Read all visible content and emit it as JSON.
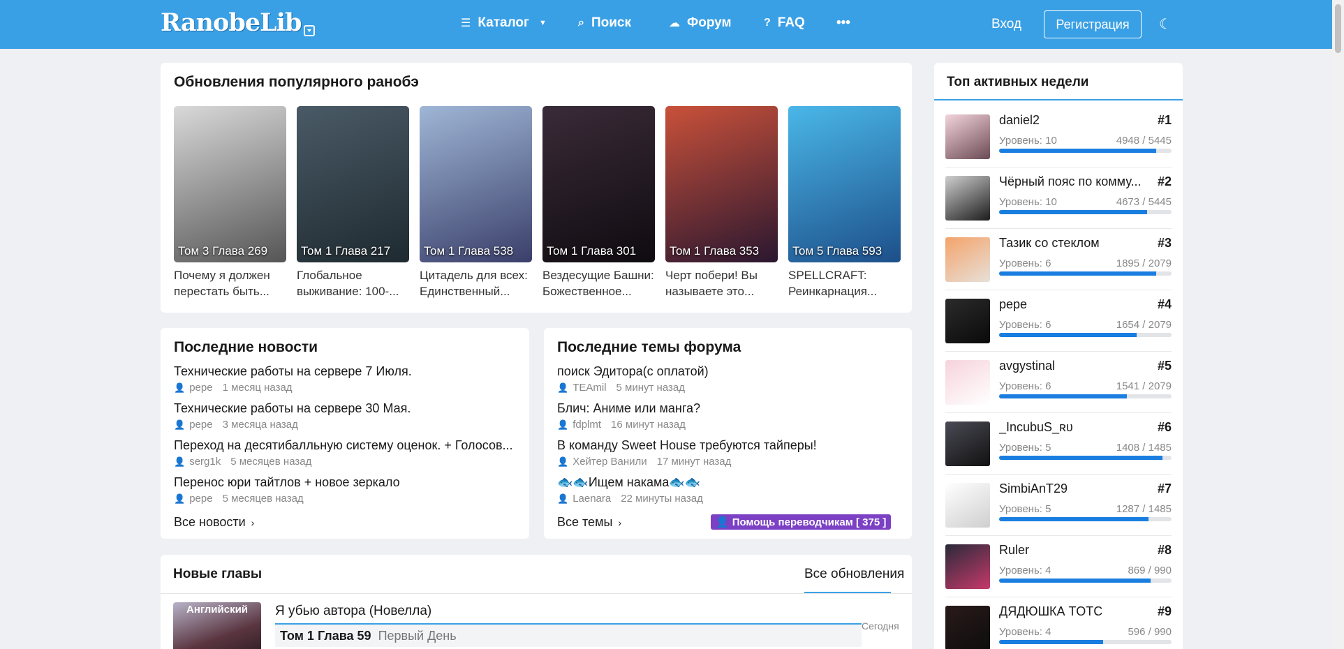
{
  "header": {
    "logo": "RanobeLib",
    "nav": [
      {
        "label": "Каталог",
        "icon": "menu-icon",
        "glyph": "☰"
      },
      {
        "label": "Поиск",
        "icon": "search-icon",
        "glyph": "⌕"
      },
      {
        "label": "Форум",
        "icon": "chat-icon",
        "glyph": "☁"
      },
      {
        "label": "FAQ",
        "icon": "question-icon",
        "glyph": "?"
      }
    ],
    "more": "•••",
    "login": "Вход",
    "register": "Регистрация"
  },
  "popular": {
    "title": "Обновления популярного ранобэ",
    "items": [
      {
        "label": "Том 3 Глава 269",
        "name": "Почему я должен перестать быть...",
        "colors": [
          "#d9d9d9",
          "#555"
        ]
      },
      {
        "label": "Том 1 Глава 217",
        "name": "Глобальное выживание: 100-...",
        "colors": [
          "#4a5a66",
          "#1e2a30"
        ]
      },
      {
        "label": "Том 1 Глава 538",
        "name": "Цитадель для всех: Единственный...",
        "colors": [
          "#9fb6d6",
          "#3a3f6a"
        ]
      },
      {
        "label": "Том 1 Глава 301",
        "name": "Вездесущие Башни: Божественное...",
        "colors": [
          "#3a2b38",
          "#0f0b10"
        ]
      },
      {
        "label": "Том 1 Глава 353",
        "name": "Черт побери! Вы называете это...",
        "colors": [
          "#c9513a",
          "#2a1730"
        ]
      },
      {
        "label": "Том 5 Глава 593",
        "name": "SPELLCRAFT: Реинкарнация...",
        "colors": [
          "#4ab7e8",
          "#1d4f8a"
        ]
      }
    ]
  },
  "news": {
    "title": "Последние новости",
    "items": [
      {
        "title": "Технические работы на сервере 7 Июля.",
        "user": "pepe",
        "time": "1 месяц назад"
      },
      {
        "title": "Технические работы на сервере 30 Мая.",
        "user": "pepe",
        "time": "3 месяца назад"
      },
      {
        "title": "Переход на десятибалльную систему оценок. + Голосов...",
        "user": "serg1k",
        "time": "5 месяцев назад"
      },
      {
        "title": "Перенос юри тайтлов + новое зеркало",
        "user": "pepe",
        "time": "5 месяцев назад"
      }
    ],
    "all": "Все новости"
  },
  "forum": {
    "title": "Последние темы форума",
    "items": [
      {
        "title": "поиск Эдитора(с оплатой)",
        "user": "TEAmil",
        "time": "5 минут назад"
      },
      {
        "title": "Блич: Аниме или манга?",
        "user": "fdplmt",
        "time": "16 минут назад"
      },
      {
        "title": "В команду Sweet House требуются тайперы!",
        "user": "Хейтер Ванили",
        "time": "17 минут назад"
      },
      {
        "title": "🐟🐟Ищем накама🐟🐟",
        "user": "Laenara",
        "time": "22 минуты назад"
      }
    ],
    "all": "Все темы",
    "help": "Помощь переводчикам [ 375 ]"
  },
  "chapters": {
    "title": "Новые главы",
    "all": "Все обновления",
    "item": {
      "lang": "Английский",
      "name": "Я убью автора (Новелла)",
      "chapter": "Том 1 Глава 59",
      "chapter_name": "Первый День",
      "date": "Сегодня"
    }
  },
  "top": {
    "title": "Топ активных недели",
    "users": [
      {
        "name": "daniel2",
        "rank": "#1",
        "level": "Уровень: 10",
        "xp": "4948 / 5445",
        "progress": 0.909,
        "colors": [
          "#f4d4dc",
          "#6b4a55"
        ]
      },
      {
        "name": "Чёрный пояс по комму...",
        "rank": "#2",
        "level": "Уровень: 10",
        "xp": "4673 / 5445",
        "progress": 0.858,
        "colors": [
          "#cfcfcf",
          "#1c1c1c"
        ]
      },
      {
        "name": "Тазик со стеклом",
        "rank": "#3",
        "level": "Уровень: 6",
        "xp": "1895 / 2079",
        "progress": 0.911,
        "colors": [
          "#f4a36a",
          "#e7e0d8"
        ]
      },
      {
        "name": "pepe",
        "rank": "#4",
        "level": "Уровень: 6",
        "xp": "1654 / 2079",
        "progress": 0.796,
        "colors": [
          "#2b2b2b",
          "#0a0a0a"
        ]
      },
      {
        "name": "avgystinal",
        "rank": "#5",
        "level": "Уровень: 6",
        "xp": "1541 / 2079",
        "progress": 0.741,
        "colors": [
          "#f6d3dc",
          "#ffffff"
        ]
      },
      {
        "name": "_IncubuS_ʀᴜ",
        "rank": "#6",
        "level": "Уровень: 5",
        "xp": "1408 / 1485",
        "progress": 0.948,
        "colors": [
          "#4a4a55",
          "#111"
        ]
      },
      {
        "name": "SimbiAnT29",
        "rank": "#7",
        "level": "Уровень: 5",
        "xp": "1287 / 1485",
        "progress": 0.867,
        "colors": [
          "#ffffff",
          "#cfcfcf"
        ]
      },
      {
        "name": "Ruler",
        "rank": "#8",
        "level": "Уровень: 4",
        "xp": "869 / 990",
        "progress": 0.878,
        "colors": [
          "#2a2a3a",
          "#c63a6a"
        ]
      },
      {
        "name": "ДЯДЮШКА TOTC",
        "rank": "#9",
        "level": "Уровень: 4",
        "xp": "596 / 990",
        "progress": 0.602,
        "colors": [
          "#2a1a1a",
          "#0d0d0d"
        ]
      }
    ]
  },
  "colors": {
    "accent": "#3aa0e5",
    "progress": "#1a7ee0",
    "badge": "#7b40c4"
  }
}
